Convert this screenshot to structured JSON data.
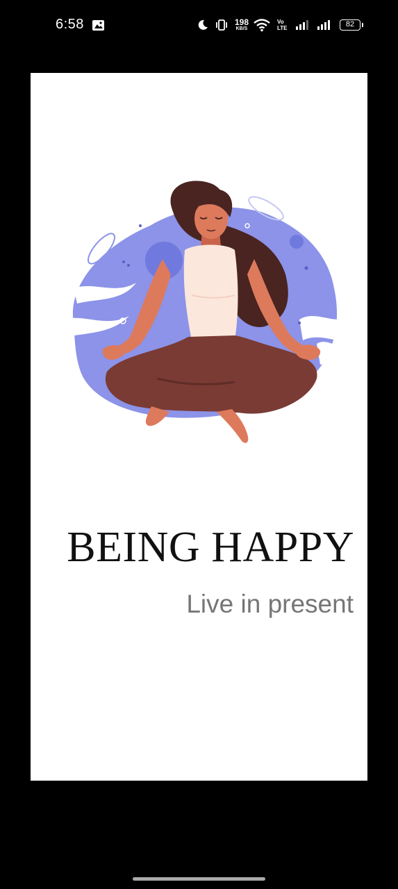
{
  "status_bar": {
    "time": "6:58",
    "net_speed_value": "198",
    "net_speed_unit": "KB/S",
    "volte_label": "Vo LTE",
    "battery_level": "82"
  },
  "splash": {
    "title": "BEING HAPPY",
    "subtitle": "Live in present"
  },
  "colors": {
    "background": "#ffffff",
    "blob": "#8c93e8",
    "hair": "#4a2420",
    "skin": "#dd7a5c",
    "top": "#fce7dc",
    "pants": "#7a3b34",
    "subtitle": "#767676"
  },
  "icons": [
    "gallery-notification-icon",
    "moon-icon",
    "vibrate-icon",
    "wifi-icon",
    "signal-icon",
    "battery-icon"
  ]
}
